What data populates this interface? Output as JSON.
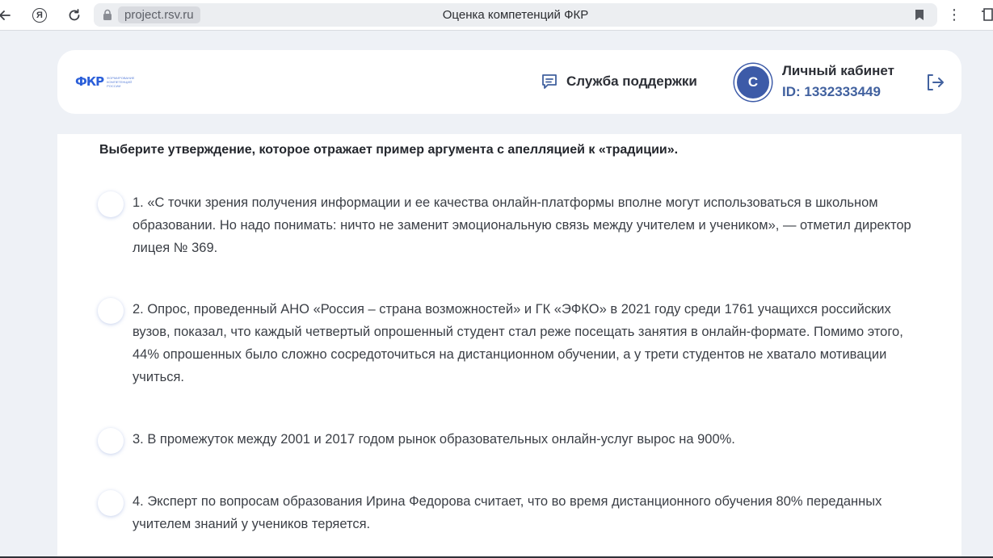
{
  "browser": {
    "url": "project.rsv.ru",
    "tab_title": "Оценка компетенций ФКР",
    "yandex_glyph": "Я",
    "menu_glyph": "⋮"
  },
  "header": {
    "logo_mark": "ФКР",
    "logo_text": "ФОРМИРОВАНИЕ КОМПЕТЕНЦИЙ РОССИИ",
    "support_label": "Служба поддержки",
    "avatar_letter": "С",
    "account_title": "Личный кабинет",
    "account_id": "ID: 1332333449"
  },
  "question": {
    "text": "Выберите утверждение, которое отражает пример аргумента с апелляцией к «традиции».",
    "options": [
      {
        "label": "1. «С точки зрения получения информации и ее качества онлайн-платформы вполне могут использоваться в школьном образовании. Но надо понимать: ничто не заменит эмоциональную связь между учителем и учеником», — отметил директор лицея № 369."
      },
      {
        "label": "2. Опрос, проведенный АНО «Россия – страна возможностей» и ГК «ЭФКО» в 2021 году среди 1761 учащихся российских вузов, показал, что каждый четвертый опрошенный студент стал реже посещать занятия в онлайн-формате. Помимо этого, 44% опрошенных было сложно сосредоточиться на дистанционном обучении, а у трети студентов не хватало мотивации учиться."
      },
      {
        "label": "3. В промежуток между 2001 и 2017 годом рынок образовательных онлайн-услуг вырос на 900%."
      },
      {
        "label": "4. Эксперт по вопросам образования Ирина Федорова считает, что во время дистанционного обучения 80% переданных учителем знаний у учеников теряется."
      }
    ]
  },
  "colors": {
    "accent": "#3d5ba8",
    "id_text": "#41619f",
    "page_bg": "#eef1f6"
  }
}
